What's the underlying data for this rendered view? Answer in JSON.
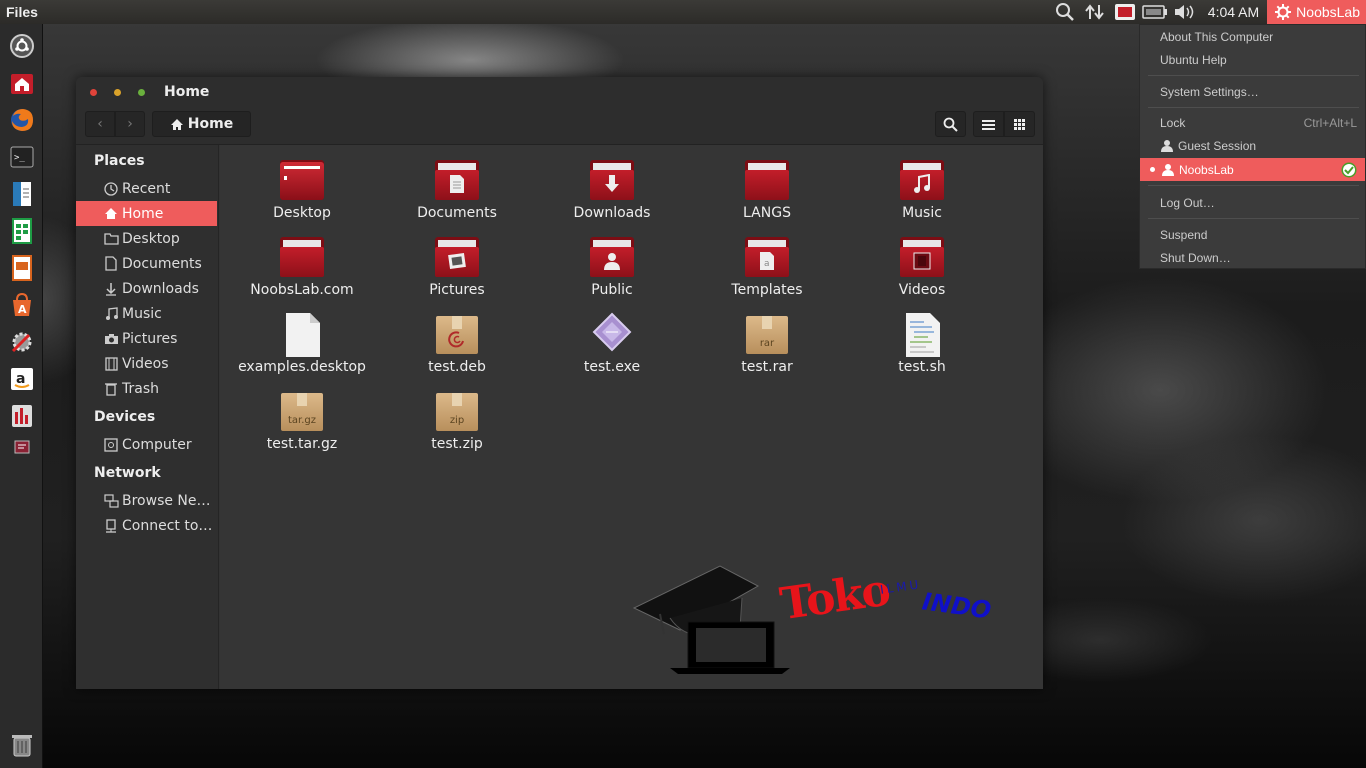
{
  "panel": {
    "app_title": "Files",
    "time": "4:04 AM",
    "user": "NoobsLab"
  },
  "window": {
    "title": "Home",
    "path_button": "Home"
  },
  "sidebar": {
    "places_heading": "Places",
    "places": [
      {
        "label": "Recent",
        "icon": "clock-icon"
      },
      {
        "label": "Home",
        "icon": "home-icon",
        "active": true
      },
      {
        "label": "Desktop",
        "icon": "folder-icon"
      },
      {
        "label": "Documents",
        "icon": "document-icon"
      },
      {
        "label": "Downloads",
        "icon": "download-icon"
      },
      {
        "label": "Music",
        "icon": "music-icon"
      },
      {
        "label": "Pictures",
        "icon": "camera-icon"
      },
      {
        "label": "Videos",
        "icon": "film-icon"
      },
      {
        "label": "Trash",
        "icon": "trash-icon"
      }
    ],
    "devices_heading": "Devices",
    "devices": [
      {
        "label": "Computer",
        "icon": "drive-icon"
      }
    ],
    "network_heading": "Network",
    "network": [
      {
        "label": "Browse Ne…",
        "icon": "network-icon"
      },
      {
        "label": "Connect to…",
        "icon": "server-icon"
      }
    ]
  },
  "files": [
    {
      "name": "Desktop",
      "kind": "folder"
    },
    {
      "name": "Documents",
      "kind": "folder"
    },
    {
      "name": "Downloads",
      "kind": "folder"
    },
    {
      "name": "LANGS",
      "kind": "folder"
    },
    {
      "name": "Music",
      "kind": "folder"
    },
    {
      "name": "NoobsLab.com",
      "kind": "folder"
    },
    {
      "name": "Pictures",
      "kind": "folder"
    },
    {
      "name": "Public",
      "kind": "folder"
    },
    {
      "name": "Templates",
      "kind": "folder"
    },
    {
      "name": "Videos",
      "kind": "folder"
    },
    {
      "name": "examples.desktop",
      "kind": "document"
    },
    {
      "name": "test.deb",
      "kind": "package"
    },
    {
      "name": "test.exe",
      "kind": "executable"
    },
    {
      "name": "test.rar",
      "kind": "archive",
      "badge": "rar"
    },
    {
      "name": "test.sh",
      "kind": "script"
    },
    {
      "name": "test.tar.gz",
      "kind": "archive",
      "badge": "tar.gz"
    },
    {
      "name": "test.zip",
      "kind": "archive",
      "badge": "zip"
    }
  ],
  "user_menu": {
    "about": "About This Computer",
    "help": "Ubuntu Help",
    "settings": "System Settings…",
    "lock": "Lock",
    "lock_accel": "Ctrl+Alt+L",
    "guest": "Guest Session",
    "current_user": "NoobsLab",
    "logout": "Log Out…",
    "suspend": "Suspend",
    "shutdown": "Shut Down…"
  },
  "watermark": {
    "word1": "Toko",
    "word2": "ILMU",
    "word3": "INDO"
  },
  "colors": {
    "accent": "#ef5c5c",
    "folder_red": "#c31e2a"
  }
}
